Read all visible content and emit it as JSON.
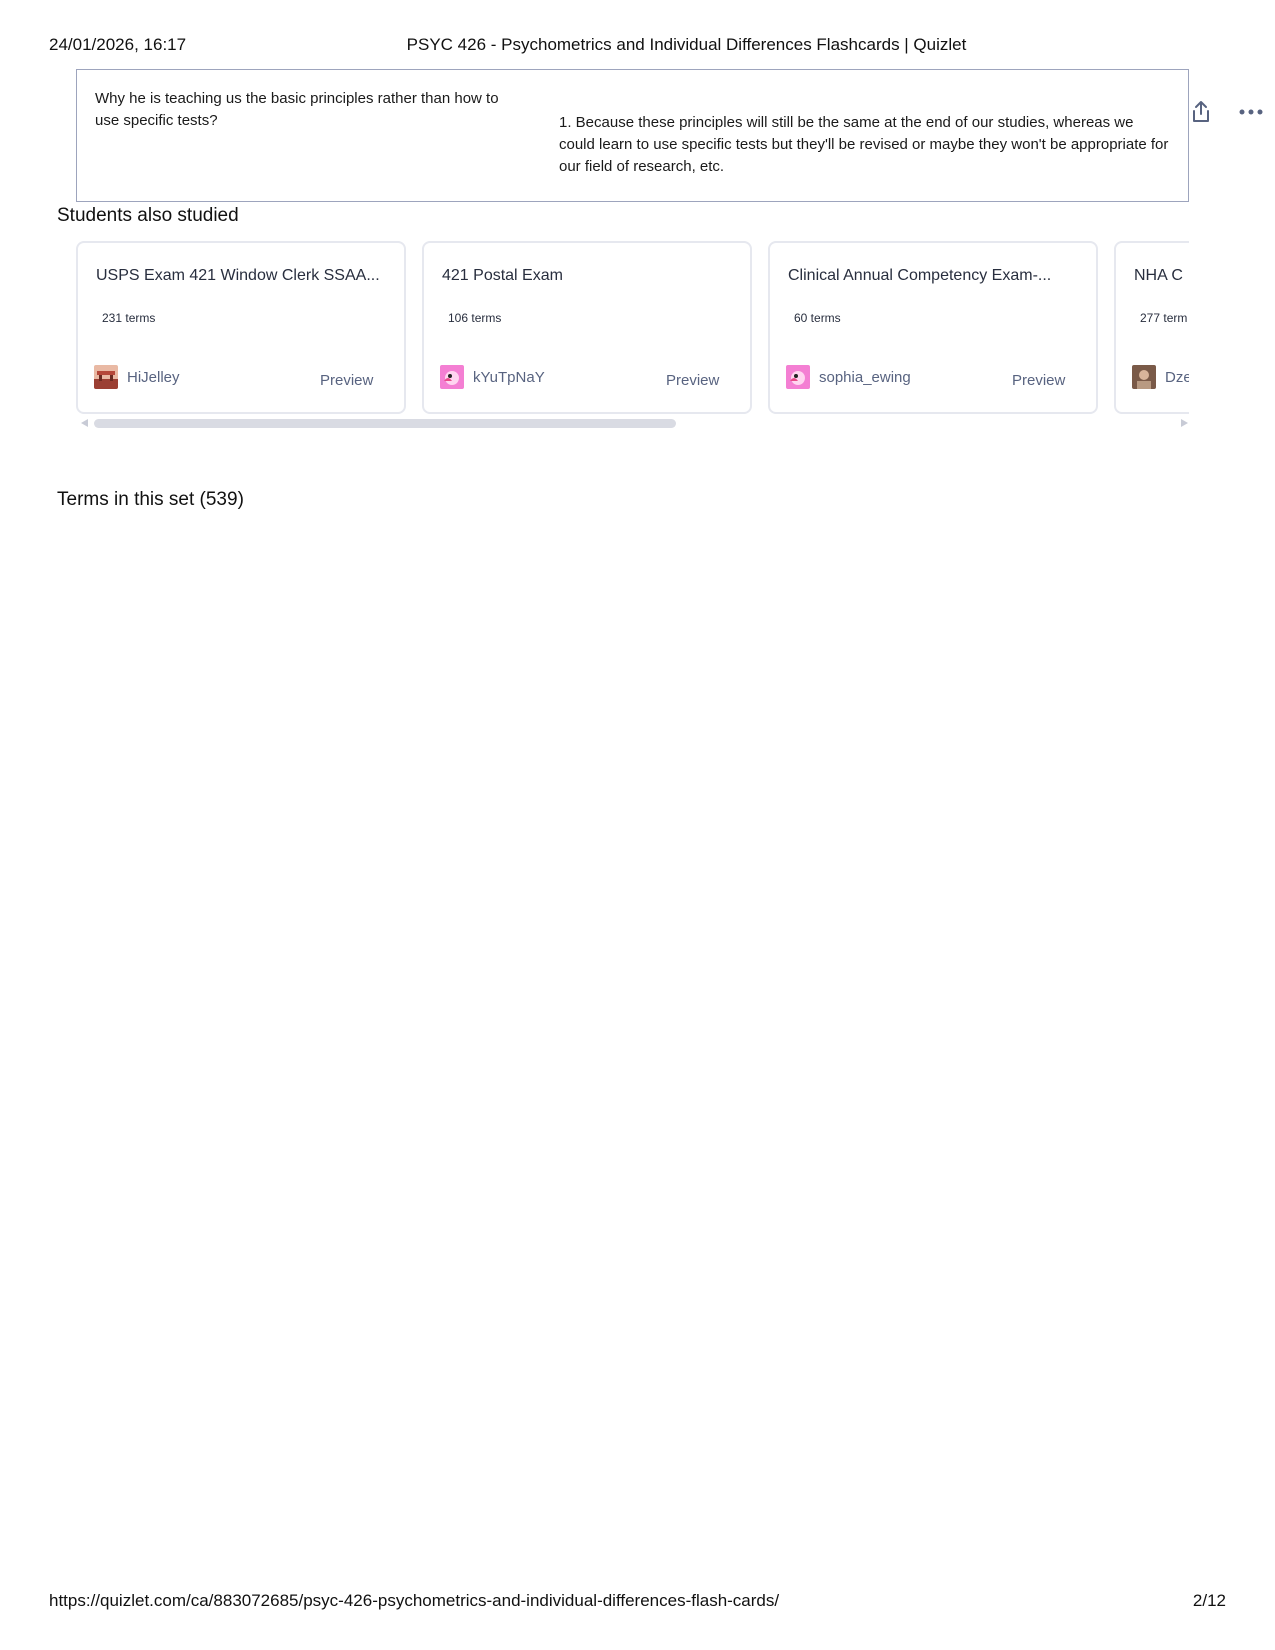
{
  "print_header": {
    "date": "24/01/2026, 16:17",
    "title": "PSYC 426 - Psychometrics and Individual Differences Flashcards | Quizlet"
  },
  "term_card": {
    "term": "Why he is teaching us the basic principles rather than how to use specific tests?",
    "definition": "1. Because these principles will still be the same at the end of our studies, whereas we could learn to use specific tests but they'll be revised or maybe they won't be appropriate for our field of research, etc."
  },
  "actions": {
    "share_icon": "share-icon",
    "more_icon": "more-horizontal-icon"
  },
  "students_also_studied": {
    "title": "Students also studied",
    "sets": [
      {
        "title": "USPS Exam 421 Window Clerk SSAA...",
        "count": "231 terms",
        "author": "HiJelley",
        "preview": "Preview",
        "avatar_color": "#b86a5a"
      },
      {
        "title": "421 Postal Exam",
        "count": "106 terms",
        "author": "kYuTpNaY",
        "preview": "Preview",
        "avatar_color": "#f47fd3"
      },
      {
        "title": "Clinical Annual Competency Exam-...",
        "count": "60 terms",
        "author": "sophia_ewing",
        "preview": "Preview",
        "avatar_color": "#f47fd3"
      },
      {
        "title": "NHA C",
        "count": "277 term",
        "author": "Dze",
        "preview": "",
        "avatar_color": "#7a5a48"
      }
    ]
  },
  "terms_section": {
    "title": "Terms in this set (539)"
  },
  "print_footer": {
    "url": "https://quizlet.com/ca/883072685/psyc-426-psychometrics-and-individual-differences-flash-cards/",
    "page": "2/12"
  }
}
